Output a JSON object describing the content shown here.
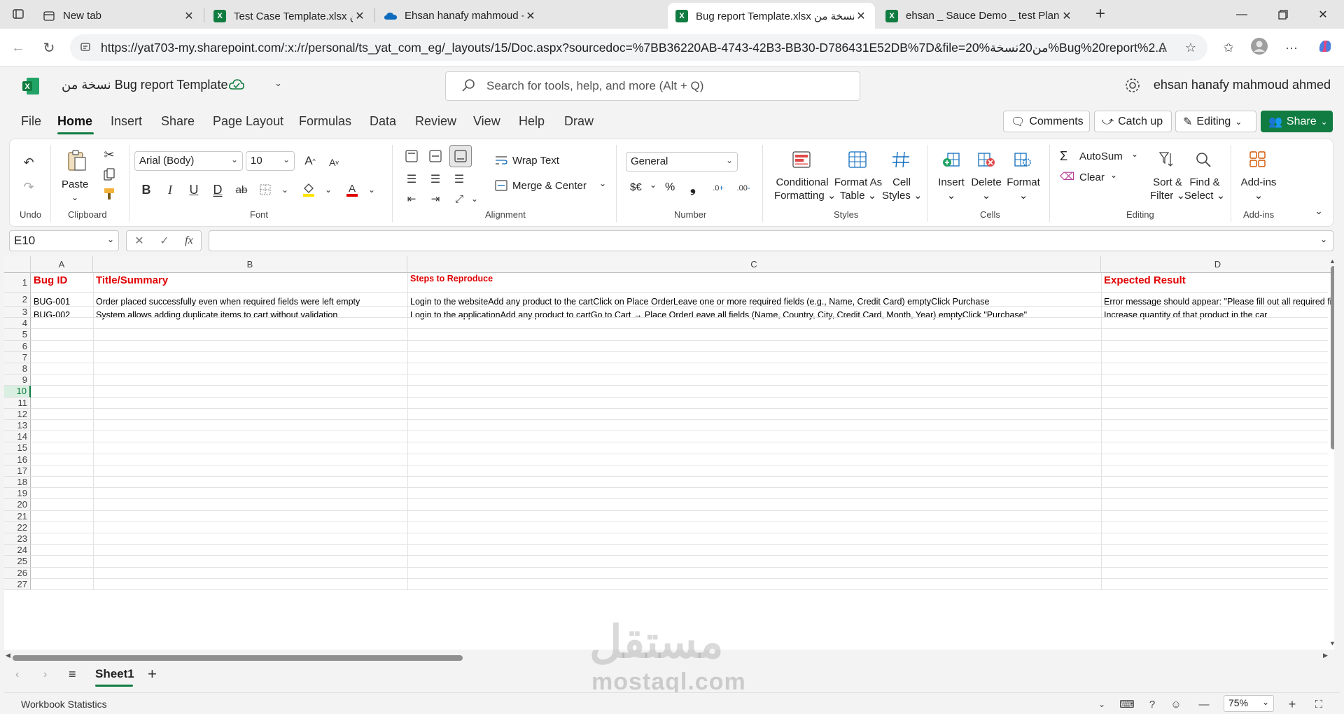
{
  "browser": {
    "tabs": [
      {
        "title": "New tab",
        "icon": "newtab-icon"
      },
      {
        "title": "Test Case Template.xlsx نسخة من",
        "icon": "excel-icon"
      },
      {
        "title": "Ehsan hanafy mahmoud - OneDri",
        "icon": "onedrive-icon"
      },
      {
        "title": "Bug report Template.xlsx نسخة من",
        "icon": "excel-icon",
        "active": true
      },
      {
        "title": "ehsan _ Sauce Demo _ test Plan.xl",
        "icon": "excel-icon"
      }
    ],
    "url": "https://yat703-my.sharepoint.com/:x:/r/personal/ts_yat_com_eg/_layouts/15/Doc.aspx?sourcedoc=%7BB36220AB-4743-42B3-BB30-D786431E52DB%7D&file=20%من20نسخة%Bug%20report%2..."
  },
  "app": {
    "doc_title": "نسخة من Bug report Template",
    "search_placeholder": "Search for tools, help, and more (Alt + Q)",
    "user": "ehsan hanafy mahmoud ahmed",
    "brand_color": "#107c41"
  },
  "menu": {
    "items": [
      "File",
      "Home",
      "Insert",
      "Share",
      "Page Layout",
      "Formulas",
      "Data",
      "Review",
      "View",
      "Help",
      "Draw"
    ],
    "active": "Home",
    "comments": "Comments",
    "catchup": "Catch up",
    "editing": "Editing",
    "share": "Share"
  },
  "ribbon": {
    "undo_label": "Undo",
    "paste": "Paste",
    "clipboard_label": "Clipboard",
    "font_name": "Arial (Body)",
    "font_size": "10",
    "font_label": "Font",
    "wrap_text": "Wrap Text",
    "merge_center": "Merge & Center",
    "alignment_label": "Alignment",
    "number_format": "General",
    "currency": "$€",
    "percent": "%",
    "comma": "❟",
    "number_label": "Number",
    "cond_fmt_1": "Conditional",
    "cond_fmt_2": "Formatting",
    "fmt_table_1": "Format As",
    "fmt_table_2": "Table",
    "cell_styles_1": "Cell",
    "cell_styles_2": "Styles",
    "styles_label": "Styles",
    "insert": "Insert",
    "delete": "Delete",
    "format": "Format",
    "cells_label": "Cells",
    "autosum": "AutoSum",
    "clear": "Clear",
    "sort_1": "Sort &",
    "sort_2": "Filter",
    "find_1": "Find &",
    "find_2": "Select",
    "editing_label": "Editing",
    "addins": "Add-ins",
    "addins_label": "Add-ins"
  },
  "formula_bar": {
    "name_box": "E10",
    "fx": "fx",
    "value": ""
  },
  "sheet": {
    "columns": [
      "A",
      "B",
      "C",
      "D"
    ],
    "rows": [
      "1",
      "2",
      "3",
      "4",
      "5",
      "6",
      "7",
      "8",
      "9",
      "10",
      "11",
      "12",
      "13",
      "14",
      "15",
      "16",
      "17",
      "18",
      "19",
      "20",
      "21",
      "22",
      "23",
      "24",
      "25",
      "26",
      "27"
    ],
    "selected_row": "10",
    "header": {
      "a": "Bug ID",
      "b": "Title/Summary",
      "c": "Steps to Reproduce",
      "d": "Expected Result"
    },
    "data": [
      {
        "a": "BUG-001",
        "b": "Order placed successfully even when required fields were left empty",
        "c": "Login to the websiteAdd any product to the cartClick on Place OrderLeave one or more required fields (e.g., Name, Credit Card) emptyClick Purchase",
        "d": "Error message should appear: \"Please fill out all required fie"
      },
      {
        "a": "BUG-002",
        "b": "System allows adding duplicate items to cart without validation",
        "c": "Login to the applicationAdd any product to cartGo to Cart → Place OrderLeave all fields (Name, Country, City, Credit Card, Month, Year) emptyClick \"Purchase\"",
        "d": "Increase quantity of that product in the car"
      }
    ]
  },
  "sheet_tabs": {
    "active": "Sheet1",
    "add": "+"
  },
  "status": {
    "workbook_stats": "Workbook Statistics",
    "zoom": "75%"
  },
  "watermark": {
    "text": "mostaql.com",
    "arabic": "مستقل"
  }
}
